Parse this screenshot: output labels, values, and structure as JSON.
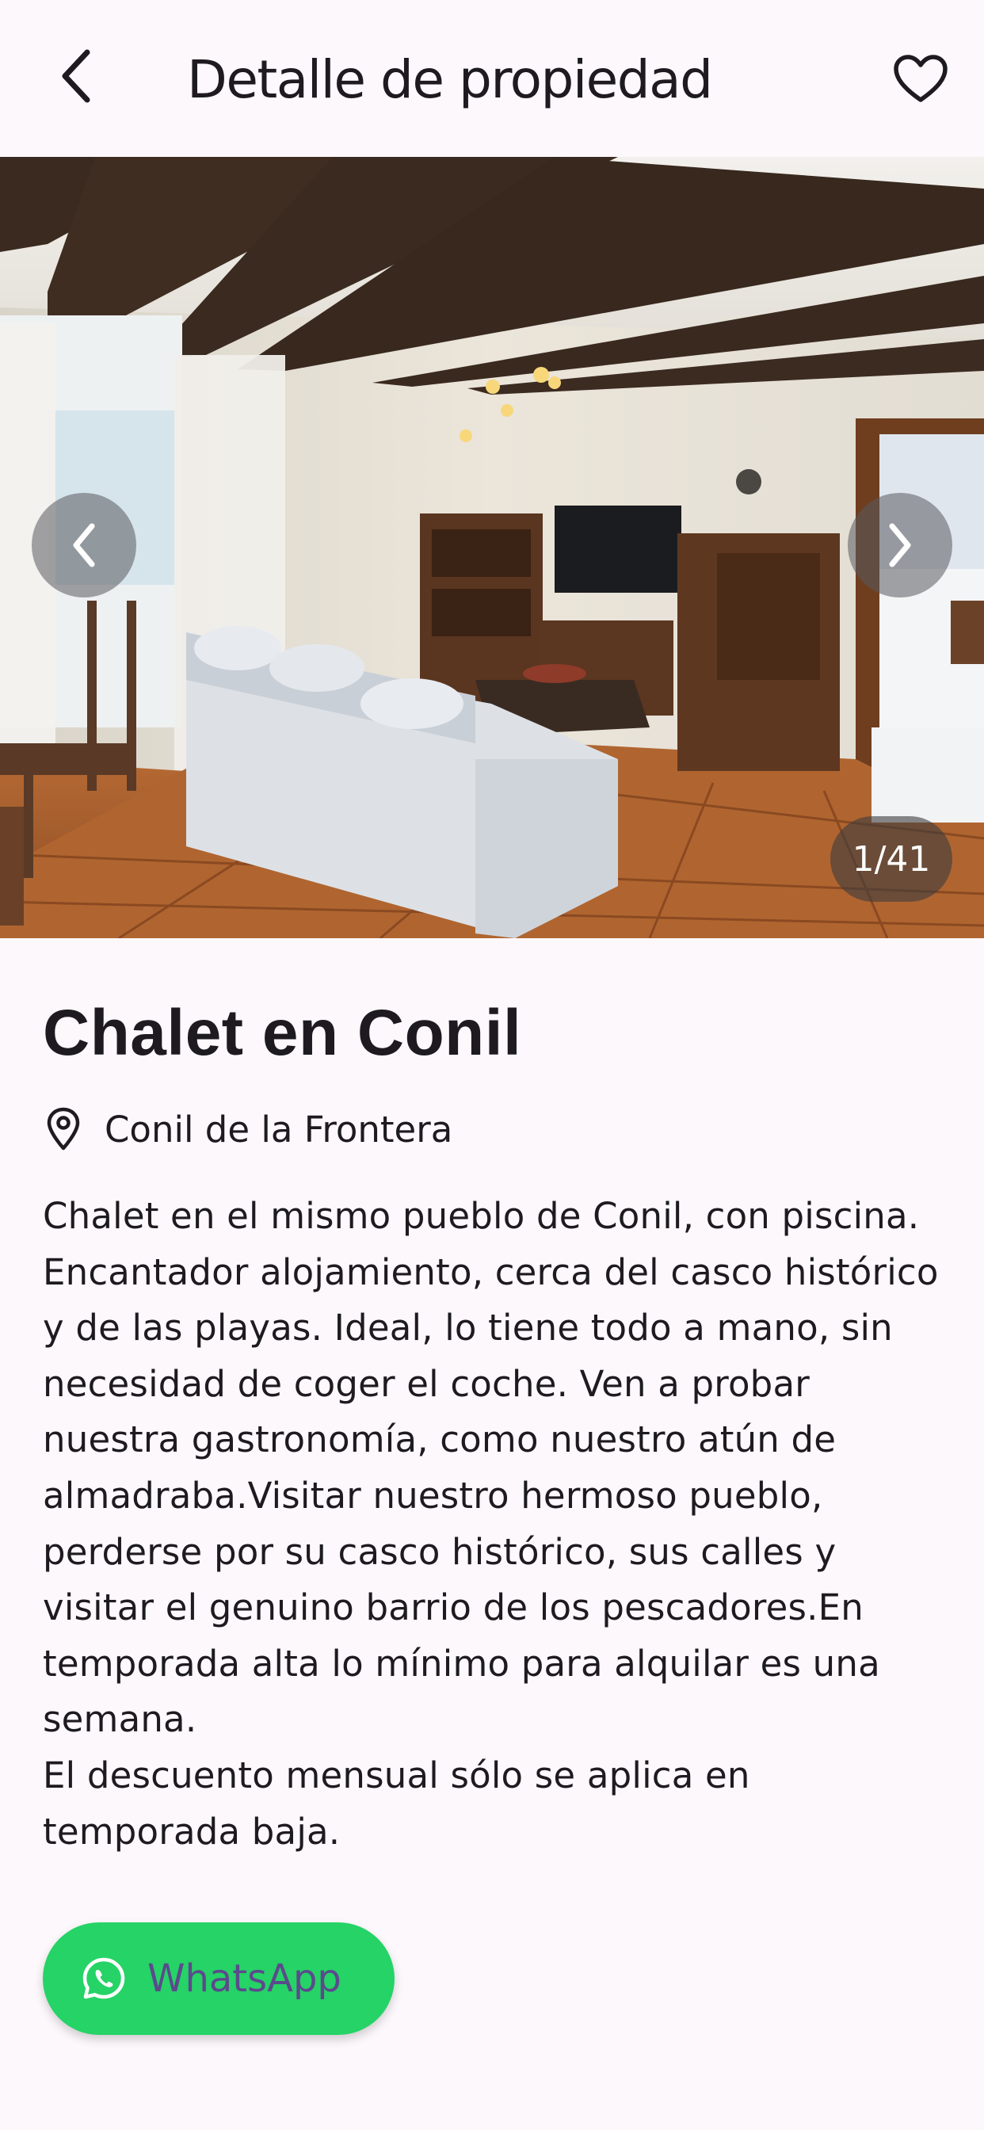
{
  "appbar": {
    "title": "Detalle de propiedad",
    "back_icon": "arrow-back-icon",
    "favorite_icon": "heart-outline-icon"
  },
  "gallery": {
    "counter": "1/41",
    "prev_icon": "chevron-left-icon",
    "next_icon": "chevron-right-icon"
  },
  "property": {
    "title": "Chalet en Conil",
    "location": "Conil de la Frontera",
    "description": "Chalet en el mismo pueblo de Conil, con piscina.\nEncantador alojamiento, cerca del casco histórico\ny de las playas. Ideal, lo tiene todo a mano, sin\nnecesidad de coger el coche. Ven a probar\nnuestra gastronomía, como nuestro atún de\nalmadraba.Visitar nuestro hermoso pueblo,\nperderse por su casco histórico, sus calles y\nvisitar el genuino barrio de los pescadores.En\ntemporada alta lo mínimo para alquilar es una\nsemana.\nEl descuento mensual sólo se aplica en\ntemporada baja."
  },
  "contact": {
    "whatsapp_label": "WhatsApp",
    "whatsapp_icon": "whatsapp-icon"
  },
  "colors": {
    "background": "#fcf8fc",
    "text": "#1d1b1f",
    "whatsapp_green": "#25d366",
    "whatsapp_label": "#5b4a8c"
  }
}
